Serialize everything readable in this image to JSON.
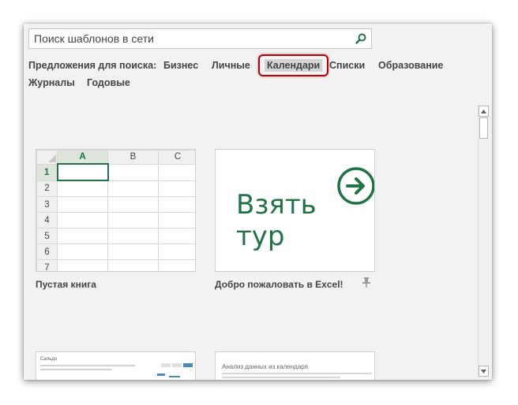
{
  "search": {
    "placeholder": "Поиск шаблонов в сети",
    "icon": "search-icon"
  },
  "suggestions": {
    "label": "Предложения для поиска:",
    "items": [
      "Бизнес",
      "Личные",
      "Календари",
      "Списки",
      "Образование",
      "Журналы",
      "Годовые"
    ]
  },
  "templates": [
    {
      "title": "Пустая книга",
      "grid": {
        "columns": [
          "A",
          "B",
          "C"
        ],
        "rows": [
          "1",
          "2",
          "3",
          "4",
          "5",
          "6",
          "7"
        ]
      }
    },
    {
      "title": "Добро пожаловать в Excel!",
      "tour_line1": "Взять",
      "tour_line2": "тур",
      "pin_icon": "pin-icon"
    },
    {
      "title": "Сальдо"
    },
    {
      "title": "Анализ данных из календаря"
    }
  ],
  "colors": {
    "excel_green": "#217346",
    "highlight_red": "#c00000"
  }
}
